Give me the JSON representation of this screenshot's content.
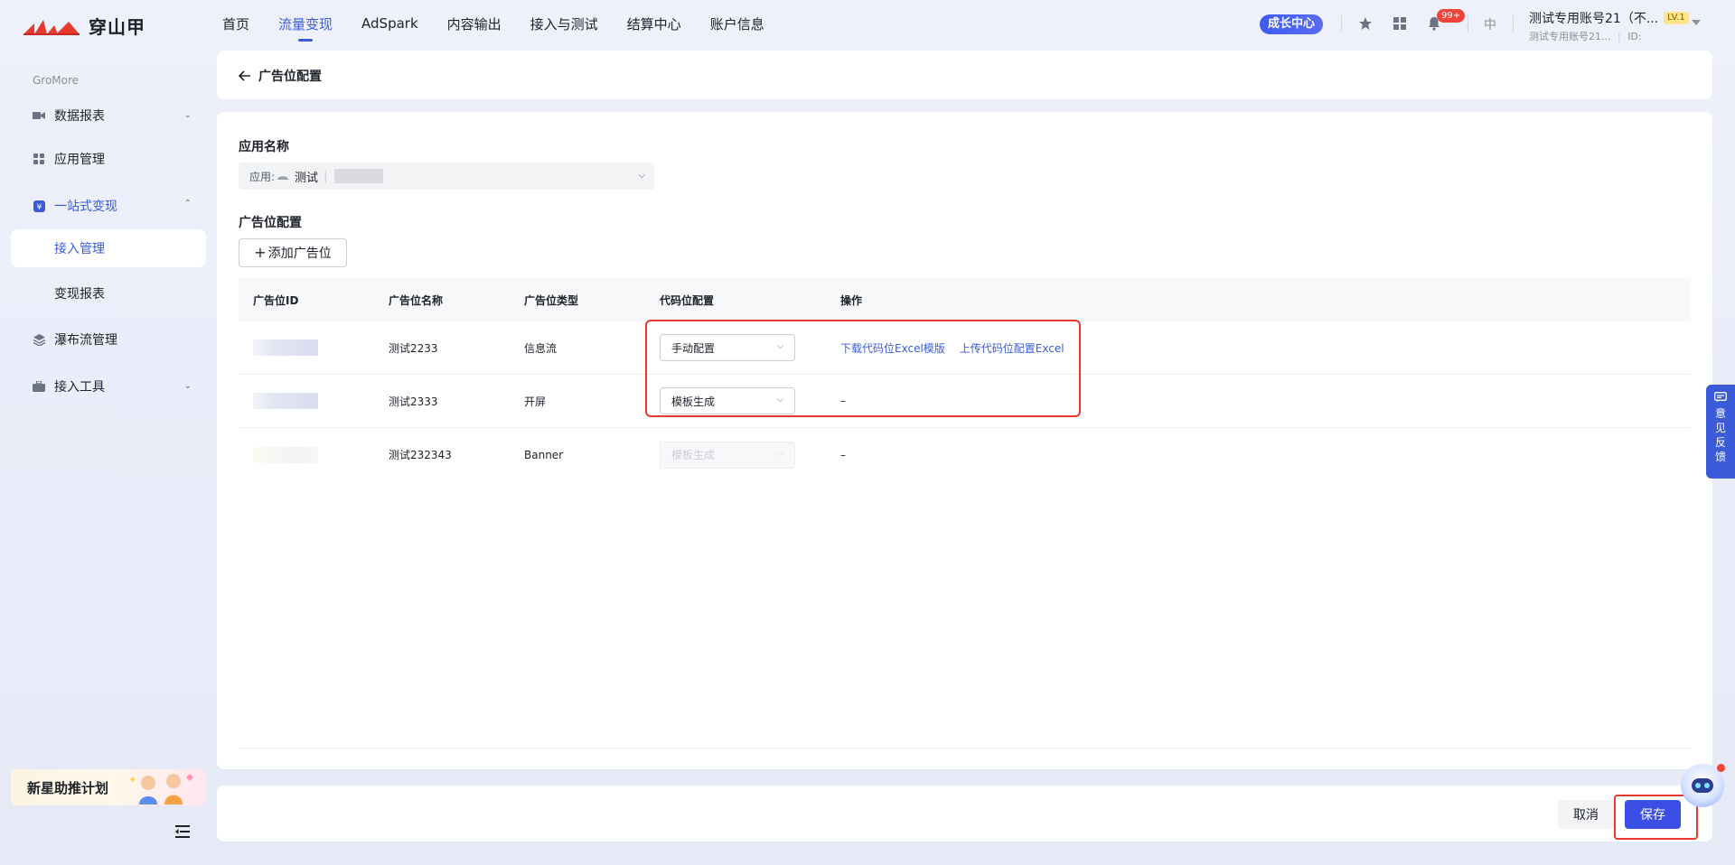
{
  "brand": {
    "name": "穿山甲"
  },
  "nav": {
    "items": [
      "首页",
      "流量变现",
      "AdSpark",
      "内容输出",
      "接入与测试",
      "结算中心",
      "账户信息"
    ],
    "active_index": 1
  },
  "header_right": {
    "grow_center": "成长中心",
    "notif_badge": "99+",
    "lang": "中",
    "account_name": "测试专用账号21（不...",
    "level": "LV.1",
    "account_sub": "测试专用账号21...",
    "id_label": "ID:"
  },
  "sidebar": {
    "section": "GroMore",
    "items": [
      {
        "label": "数据报表",
        "icon": "video-icon"
      },
      {
        "label": "应用管理",
        "icon": "grid-icon"
      },
      {
        "label": "一站式变现",
        "icon": "yuan-icon"
      },
      {
        "label": "接入管理"
      },
      {
        "label": "变现报表"
      },
      {
        "label": "瀑布流管理",
        "icon": "layers-icon"
      },
      {
        "label": "接入工具",
        "icon": "toolbox-icon"
      }
    ],
    "promo": "新星助推计划"
  },
  "page": {
    "title": "广告位配置",
    "app_label": "应用名称",
    "app_select": {
      "prefix": "应用:",
      "value": "测试"
    },
    "ad_config_label": "广告位配置",
    "add_button": "添加广告位"
  },
  "table": {
    "headers": [
      "广告位ID",
      "广告位名称",
      "广告位类型",
      "代码位配置",
      "操作"
    ],
    "rows": [
      {
        "name": "测试2233",
        "type": "信息流",
        "config": "手动配置",
        "actions": [
          "下载代码位Excel模版",
          "上传代码位配置Excel"
        ],
        "disabled": false
      },
      {
        "name": "测试2333",
        "type": "开屏",
        "config": "模板生成",
        "actions": [
          "–"
        ],
        "disabled": false
      },
      {
        "name": "测试232343",
        "type": "Banner",
        "config": "模板生成",
        "actions": [
          "–"
        ],
        "disabled": true
      }
    ]
  },
  "footer": {
    "cancel": "取消",
    "save": "保存"
  },
  "feedback": "意见反馈",
  "colors": {
    "primary": "#3b5bdb",
    "highlight": "#e8392e",
    "save": "#3b4fe4"
  }
}
